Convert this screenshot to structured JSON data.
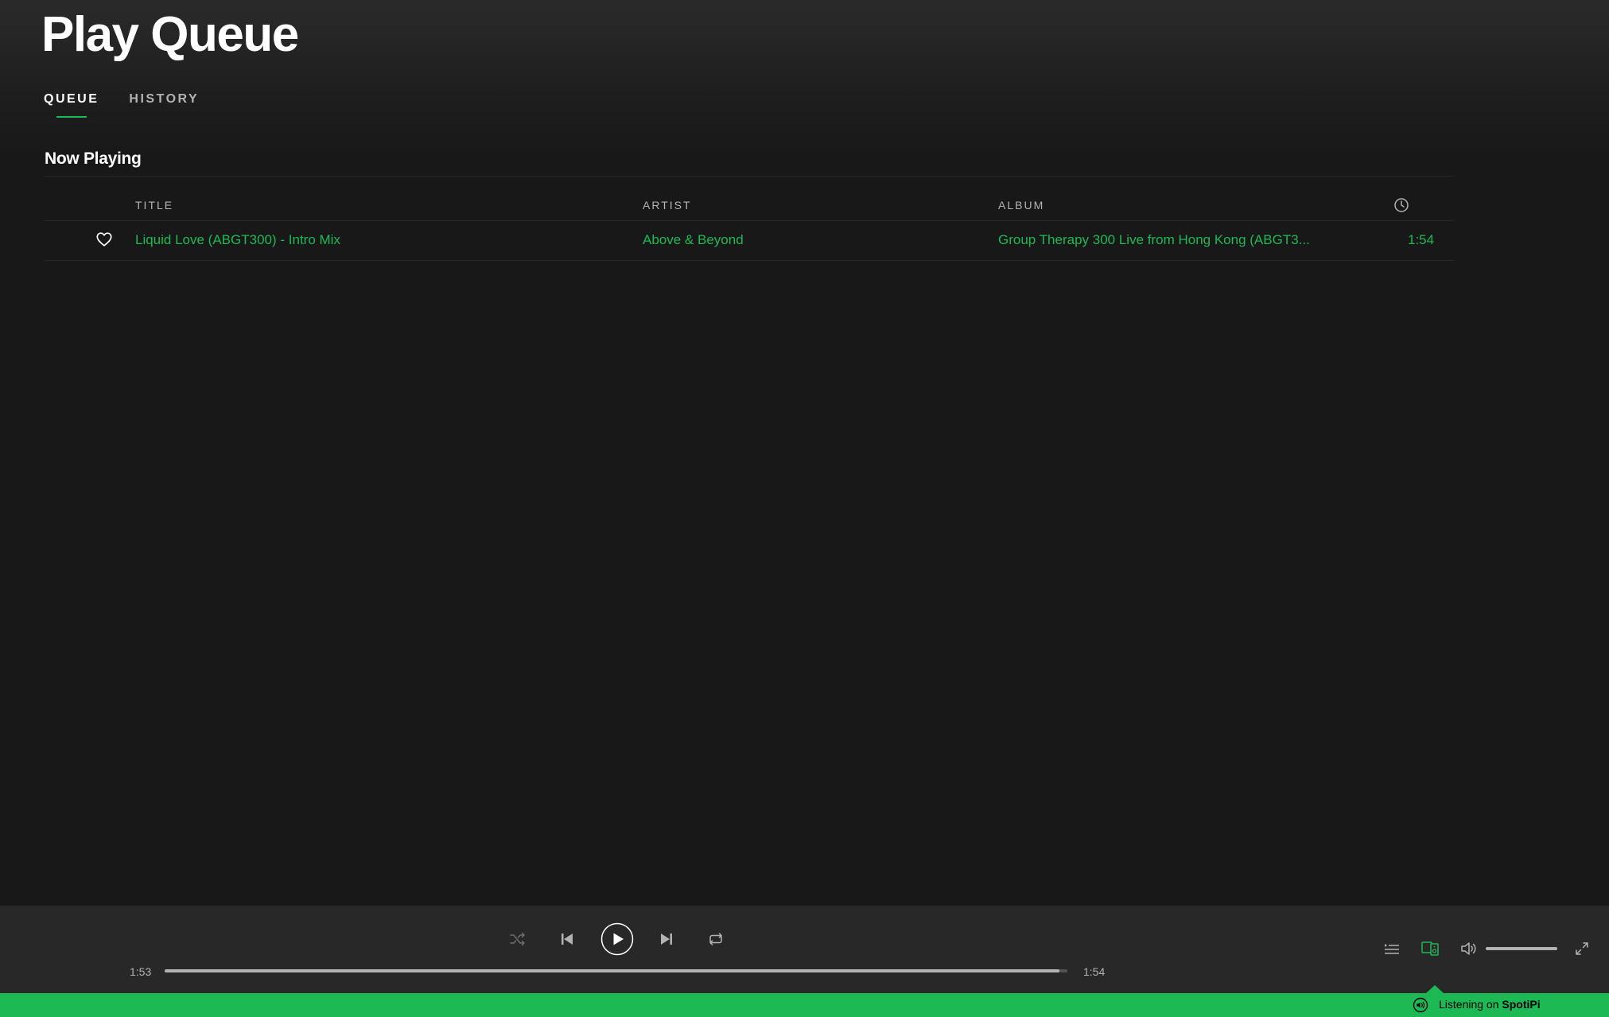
{
  "page": {
    "title": "Play Queue"
  },
  "tabs": [
    {
      "label": "QUEUE",
      "active": true
    },
    {
      "label": "HISTORY",
      "active": false
    }
  ],
  "now_playing": {
    "section_title": "Now Playing",
    "columns": {
      "title": "TITLE",
      "artist": "ARTIST",
      "album": "ALBUM",
      "duration_icon": "clock-icon"
    },
    "tracks": [
      {
        "title": "Liquid Love (ABGT300) - Intro Mix",
        "artist": "Above & Beyond",
        "album": "Group Therapy 300 Live from Hong Kong (ABGT3...",
        "duration": "1:54",
        "liked": false
      }
    ]
  },
  "player": {
    "elapsed": "1:53",
    "total": "1:54",
    "progress_fraction": 0.991,
    "volume_fraction": 1.0,
    "controls": [
      "shuffle-icon",
      "previous-icon",
      "play-icon",
      "next-icon",
      "repeat-icon"
    ],
    "right_controls": [
      "queue-icon",
      "devices-icon",
      "volume-icon",
      "fullscreen-icon"
    ]
  },
  "connect": {
    "prefix": "Listening on",
    "device": "SpotiPi"
  },
  "colors": {
    "accent": "#1db954",
    "background": "#181818",
    "player_bg": "#282828",
    "text_muted": "#b3b3b3"
  }
}
